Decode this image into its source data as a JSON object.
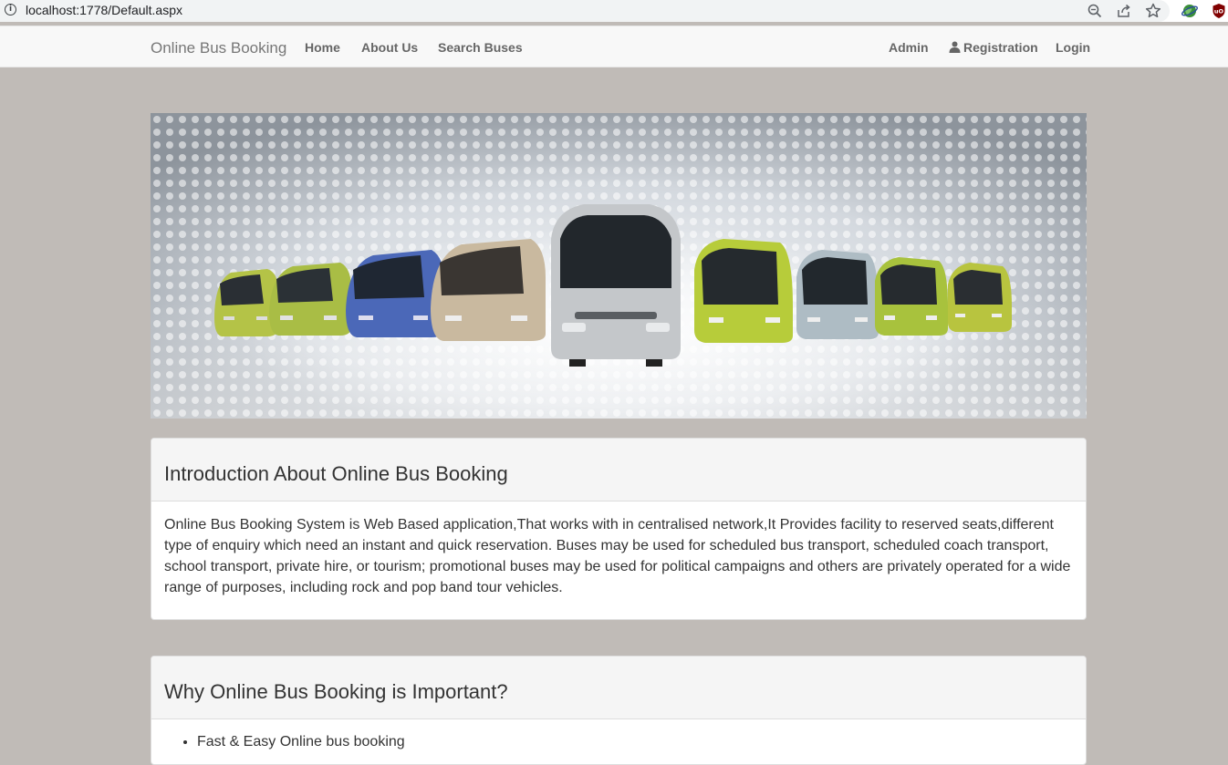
{
  "browser": {
    "url": "localhost:1778/Default.aspx",
    "icons": [
      "info-icon",
      "zoom-icon",
      "share-icon",
      "bookmark-star-icon",
      "extension-globe-icon",
      "ublock-icon"
    ]
  },
  "navbar": {
    "brand": "Online Bus Booking",
    "left_links": [
      "Home",
      "About Us",
      "Search Buses"
    ],
    "right_links": {
      "admin": "Admin",
      "registration": "Registration",
      "login": "Login"
    }
  },
  "banner": {
    "description_icon": "bus-fleet-banner-image"
  },
  "intro_panel": {
    "title": "Introduction About Online Bus Booking",
    "body": "Online Bus Booking System is Web Based application,That works with in centralised network,It Provides facility to reserved seats,different type of enquiry which need an instant and quick reservation. Buses may be used for scheduled bus transport, scheduled coach transport, school transport, private hire, or tourism; promotional buses may be used for political campaigns and others are privately operated for a wide range of purposes, including rock and pop band tour vehicles."
  },
  "why_panel": {
    "title": "Why Online Bus Booking is Important?",
    "items": [
      "Fast & Easy Online bus booking"
    ]
  },
  "colors": {
    "page_background": "#c0bbb7",
    "navbar_background": "#f8f8f8",
    "panel_heading_background": "#f5f5f5"
  }
}
